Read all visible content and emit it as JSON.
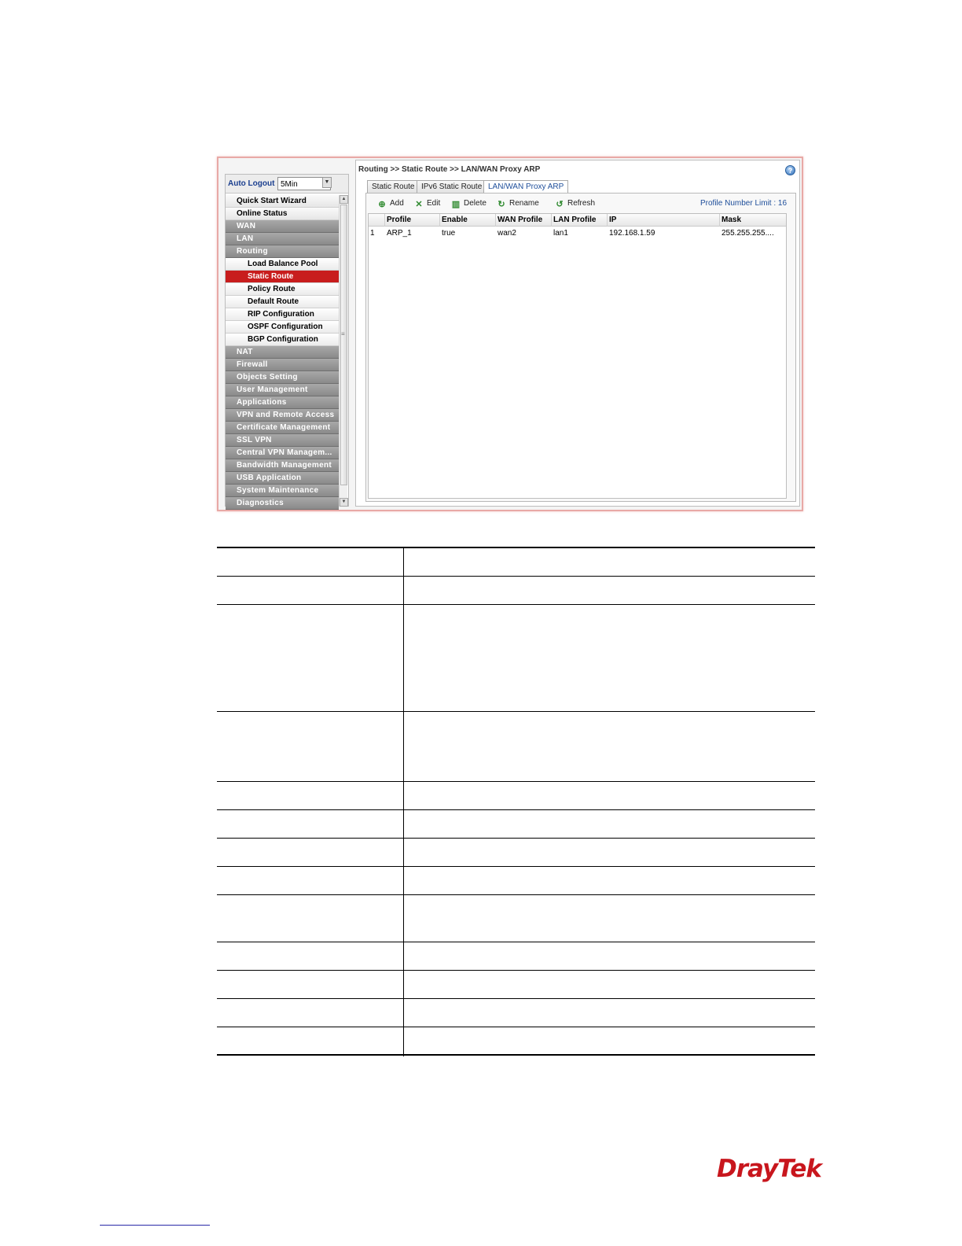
{
  "sidebar": {
    "auto_logout_label": "Auto Logout :",
    "auto_logout_value": "5Min",
    "menu": [
      {
        "label": "Quick Start Wizard",
        "kind": "plain"
      },
      {
        "label": "Online Status",
        "kind": "plain"
      },
      {
        "label": "WAN",
        "kind": "cat"
      },
      {
        "label": "LAN",
        "kind": "cat"
      },
      {
        "label": "Routing",
        "kind": "cat"
      },
      {
        "label": "Load Balance Pool",
        "kind": "sub"
      },
      {
        "label": "Static Route",
        "kind": "sub",
        "active": true
      },
      {
        "label": "Policy Route",
        "kind": "sub"
      },
      {
        "label": "Default Route",
        "kind": "sub"
      },
      {
        "label": "RIP Configuration",
        "kind": "sub"
      },
      {
        "label": "OSPF Configuration",
        "kind": "sub"
      },
      {
        "label": "BGP Configuration",
        "kind": "sub"
      },
      {
        "label": "NAT",
        "kind": "cat"
      },
      {
        "label": "Firewall",
        "kind": "cat"
      },
      {
        "label": "Objects Setting",
        "kind": "cat"
      },
      {
        "label": "User Management",
        "kind": "cat"
      },
      {
        "label": "Applications",
        "kind": "cat"
      },
      {
        "label": "VPN and Remote Access",
        "kind": "cat"
      },
      {
        "label": "Certificate Management",
        "kind": "cat"
      },
      {
        "label": "SSL VPN",
        "kind": "cat"
      },
      {
        "label": "Central VPN Managem...",
        "kind": "cat"
      },
      {
        "label": "Bandwidth Management",
        "kind": "cat"
      },
      {
        "label": "USB Application",
        "kind": "cat"
      },
      {
        "label": "System Maintenance",
        "kind": "cat"
      },
      {
        "label": "Diagnostics",
        "kind": "cat"
      }
    ]
  },
  "main": {
    "breadcrumb": "Routing >> Static Route >> LAN/WAN Proxy ARP",
    "tabs": [
      "Static Route",
      "IPv6 Static Route",
      "LAN/WAN Proxy ARP"
    ],
    "toolbar": {
      "add": "Add",
      "edit": "Edit",
      "delete": "Delete",
      "rename": "Rename",
      "refresh": "Refresh",
      "limit": "Profile Number Limit : 16"
    },
    "grid": {
      "columns": [
        "",
        "Profile",
        "Enable",
        "WAN Profile",
        "LAN Profile",
        "IP",
        "Mask"
      ],
      "rows": [
        [
          "1",
          "ARP_1",
          "true",
          "wan2",
          "lan1",
          "192.168.1.59",
          "255.255.255...."
        ]
      ]
    }
  },
  "colors": {
    "active_menu": "#c81d1d",
    "frame_border": "#e8a9a6",
    "link_blue": "#1e4e9a",
    "logo": "#c8161d"
  },
  "footer": {
    "logo_text": "DrayTek"
  }
}
